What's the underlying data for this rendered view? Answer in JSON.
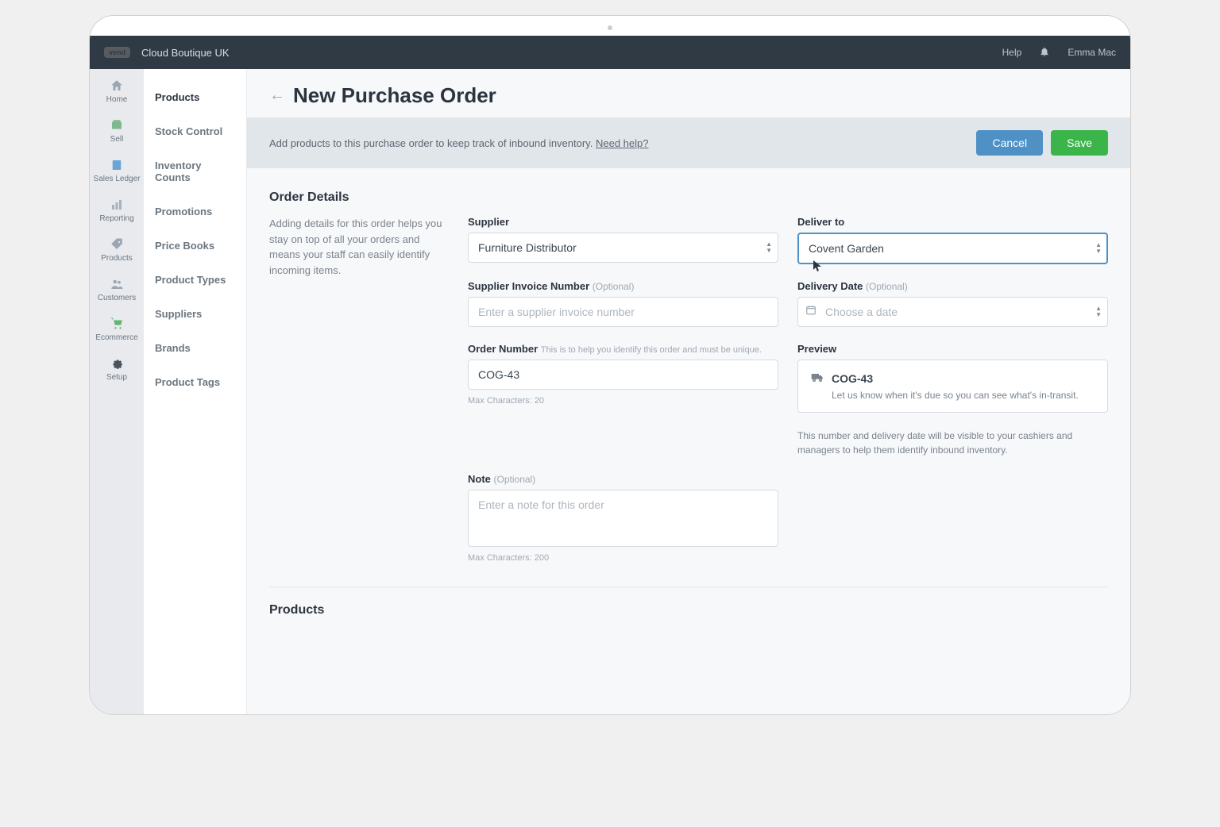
{
  "topbar": {
    "logo": "vend",
    "org": "Cloud Boutique UK",
    "help": "Help",
    "user": "Emma Mac"
  },
  "rail": {
    "items": [
      {
        "label": "Home"
      },
      {
        "label": "Sell"
      },
      {
        "label": "Sales Ledger"
      },
      {
        "label": "Reporting"
      },
      {
        "label": "Products"
      },
      {
        "label": "Customers"
      },
      {
        "label": "Ecommerce"
      },
      {
        "label": "Setup"
      }
    ]
  },
  "subnav": {
    "items": [
      {
        "label": "Products"
      },
      {
        "label": "Stock Control"
      },
      {
        "label": "Inventory Counts"
      },
      {
        "label": "Promotions"
      },
      {
        "label": "Price Books"
      },
      {
        "label": "Product Types"
      },
      {
        "label": "Suppliers"
      },
      {
        "label": "Brands"
      },
      {
        "label": "Product Tags"
      }
    ]
  },
  "page": {
    "title": "New Purchase Order",
    "hint": "Add products to this purchase order to keep track of inbound inventory.",
    "hint_link": "Need help?",
    "cancel": "Cancel",
    "save": "Save"
  },
  "order": {
    "section_title": "Order Details",
    "side_text": "Adding details for this order helps you stay on top of all your orders and means your staff can easily identify incoming items.",
    "supplier_label": "Supplier",
    "supplier_value": "Furniture Distributor",
    "deliver_to_label": "Deliver to",
    "deliver_to_value": "Covent Garden",
    "supplier_inv_label": "Supplier Invoice Number",
    "opt_text": "(Optional)",
    "supplier_inv_ph": "Enter a supplier invoice number",
    "delivery_date_label": "Delivery Date",
    "delivery_date_ph": "Choose a date",
    "order_no_label": "Order Number",
    "order_no_help": "This is to help you identify this order and must be unique.",
    "order_no_value": "COG-43",
    "order_no_max": "Max Characters: 20",
    "preview_label": "Preview",
    "preview_code": "COG-43",
    "preview_sub": "Let us know when it's due so you can see what's in-transit.",
    "preview_info": "This number and delivery date will be visible to your cashiers and managers to help them identify inbound inventory.",
    "note_label": "Note",
    "note_ph": "Enter a note for this order",
    "note_max": "Max Characters: 200"
  },
  "products": {
    "section_title": "Products"
  }
}
